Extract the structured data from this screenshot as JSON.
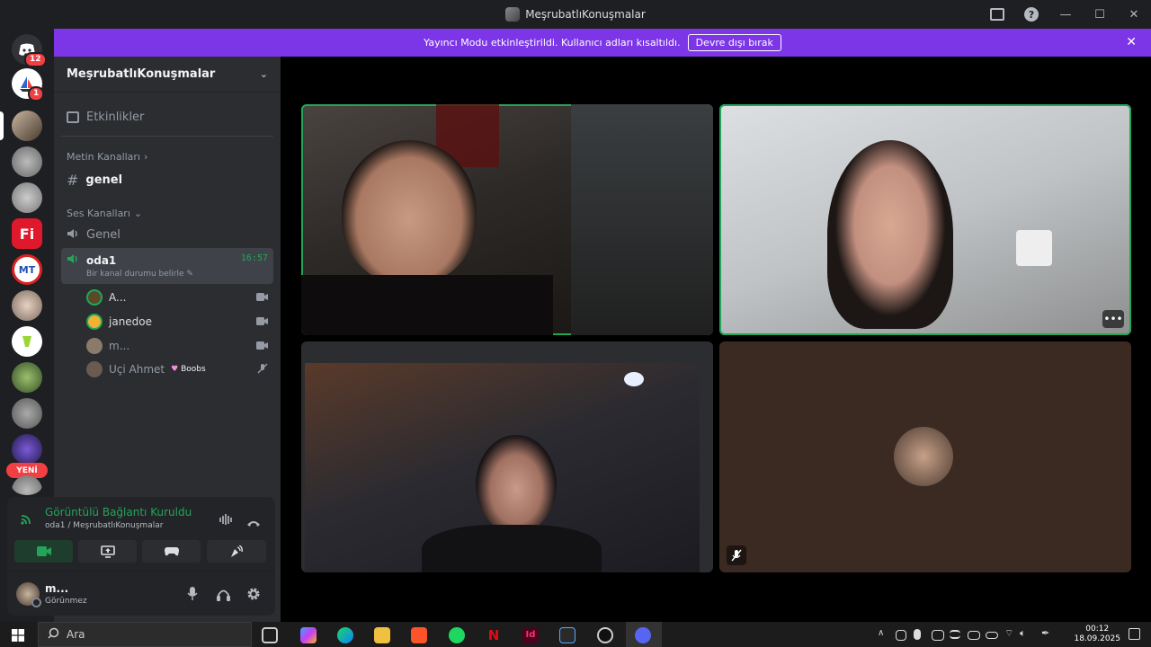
{
  "window": {
    "title": "MeşrubatlıKonuşmalar"
  },
  "banner": {
    "text": "Yayıncı Modu etkinleştirildi. Kullanıcı adları kısaltıldı.",
    "button": "Devre dışı bırak",
    "close": "✕"
  },
  "servers": {
    "dm_badge": "12",
    "second_badge": "1",
    "new_label": "YENİ"
  },
  "sidebar": {
    "guild_name": "MeşrubatlıKonuşmalar",
    "events": "Etkinlikler",
    "text_category": "Metin Kanalları",
    "text_channel": "genel",
    "voice_category": "Ses Kanalları",
    "voice_channel_1": "Genel",
    "active_channel": {
      "name": "oda1",
      "status": "Bir kanal durumu belirle",
      "time": "16:57"
    },
    "members": [
      {
        "name": "A..."
      },
      {
        "name": "janedoe"
      },
      {
        "name": "m..."
      },
      {
        "name": "Uçi Ahmet",
        "tag": "Boobs"
      }
    ]
  },
  "voice_panel": {
    "title": "Görüntülü Bağlantı Kuruldu",
    "subtitle": "oda1 / MeşrubatlıKonuşmalar"
  },
  "user": {
    "name": "m...",
    "status": "Görünmez"
  },
  "taskbar": {
    "search": "Ara",
    "time": "00:12",
    "date": "18.09.2025"
  },
  "colors": {
    "accent": "#7d35e8",
    "speaking": "#23a559",
    "sidebar": "#2b2d31"
  }
}
